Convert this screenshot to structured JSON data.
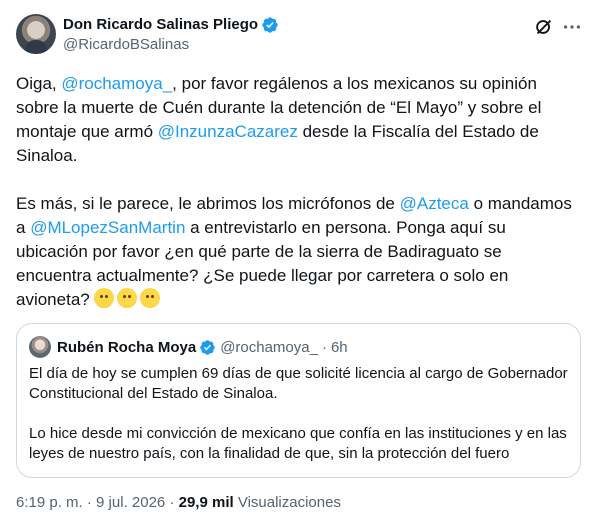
{
  "tweet": {
    "display_name": "Don Ricardo Salinas Pliego",
    "handle": "@RicardoBSalinas",
    "paragraph1": [
      {
        "t": "Oiga, ",
        "m": false
      },
      {
        "t": "@rochamoya_",
        "m": true
      },
      {
        "t": ", por favor regálenos a los mexicanos su opinión sobre la muerte de Cuén durante la detención de “El Mayo” y sobre el montaje que armó ",
        "m": false
      },
      {
        "t": "@InzunzaCazarez",
        "m": true
      },
      {
        "t": " desde la Fiscalía del Estado de Sinaloa.",
        "m": false
      }
    ],
    "paragraph2": [
      {
        "t": "Es más, si le parece, le abrimos los micrófonos de ",
        "m": false
      },
      {
        "t": "@Azteca",
        "m": true
      },
      {
        "t": " o mandamos a ",
        "m": false
      },
      {
        "t": "@MLopezSanMartin",
        "m": true
      },
      {
        "t": " a entrevistarlo en persona. Ponga aquí su ubicación por favor ¿en qué parte de la sierra de Badiraguato se encuentra actualmente? ¿Se puede llegar por carretera o solo en avioneta? ",
        "m": false
      }
    ],
    "emojis": [
      "thinking-face-emoji",
      "eye-roll-emoji",
      "relieved-face-emoji"
    ]
  },
  "quote": {
    "display_name": "Rubén Rocha Moya",
    "handle": "@rochamoya_",
    "dot": "·",
    "time": "6h",
    "line1": "El día de hoy se cumplen 69 días de que solicité licencia al cargo de Gobernador Constitucional del Estado de Sinaloa.",
    "line2": "Lo hice desde mi convicción de mexicano que confía en  las instituciones y en las leyes de nuestro país, con la finalidad de que, sin la protección del fuero"
  },
  "meta": {
    "time": "6:19 p. m.",
    "sep": "·",
    "date": "9 jul. 2026",
    "views_count": "29,9 mil",
    "views_label": "Visualizaciones"
  },
  "colors": {
    "accent": "#1d9bf0",
    "text": "#0f1419",
    "muted": "#536471",
    "border": "#cfd9de"
  },
  "icons": {
    "verified": "verified-badge-icon",
    "grok": "grok-icon",
    "more": "more-icon"
  }
}
